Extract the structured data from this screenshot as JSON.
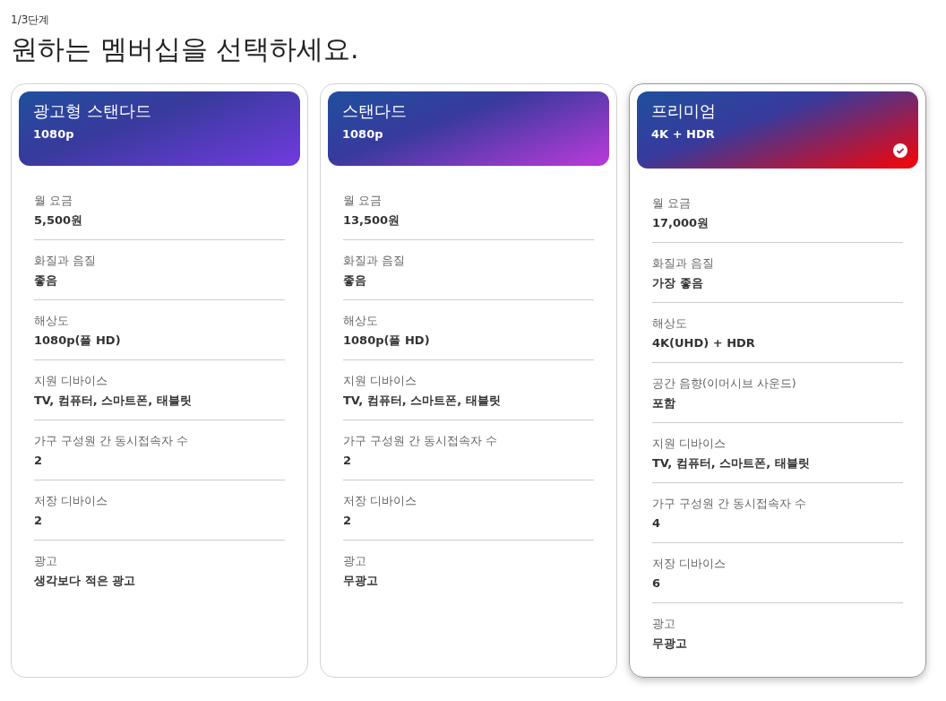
{
  "step": "1/3단계",
  "title": "원하는 멤버십을 선택하세요.",
  "plans": [
    {
      "name": "광고형 스탠다드",
      "quality": "1080p",
      "color": "#6c3bd9",
      "selected": false,
      "rows": [
        {
          "label": "월 요금",
          "value": "5,500원"
        },
        {
          "label": "화질과 음질",
          "value": "좋음"
        },
        {
          "label": "해상도",
          "value": "1080p(풀 HD)"
        },
        {
          "label": "지원 디바이스",
          "value": "TV, 컴퓨터, 스마트폰, 태블릿"
        },
        {
          "label": "가구 구성원 간 동시접속자 수",
          "value": "2"
        },
        {
          "label": "저장 디바이스",
          "value": "2"
        },
        {
          "label": "광고",
          "value": "생각보다 적은 광고"
        }
      ]
    },
    {
      "name": "스탠다드",
      "quality": "1080p",
      "color": "#b03ad6",
      "selected": false,
      "rows": [
        {
          "label": "월 요금",
          "value": "13,500원"
        },
        {
          "label": "화질과 음질",
          "value": "좋음"
        },
        {
          "label": "해상도",
          "value": "1080p(풀 HD)"
        },
        {
          "label": "지원 디바이스",
          "value": "TV, 컴퓨터, 스마트폰, 태블릿"
        },
        {
          "label": "가구 구성원 간 동시접속자 수",
          "value": "2"
        },
        {
          "label": "저장 디바이스",
          "value": "2"
        },
        {
          "label": "광고",
          "value": "무광고"
        }
      ]
    },
    {
      "name": "프리미엄",
      "quality": "4K + HDR",
      "color": "#e50914",
      "selected": true,
      "rows": [
        {
          "label": "월 요금",
          "value": "17,000원"
        },
        {
          "label": "화질과 음질",
          "value": "가장 좋음"
        },
        {
          "label": "해상도",
          "value": "4K(UHD) + HDR"
        },
        {
          "label": "공간 음향(이머시브 사운드)",
          "value": "포함"
        },
        {
          "label": "지원 디바이스",
          "value": "TV, 컴퓨터, 스마트폰, 태블릿"
        },
        {
          "label": "가구 구성원 간 동시접속자 수",
          "value": "4"
        },
        {
          "label": "저장 디바이스",
          "value": "6"
        },
        {
          "label": "광고",
          "value": "무광고"
        }
      ]
    }
  ]
}
